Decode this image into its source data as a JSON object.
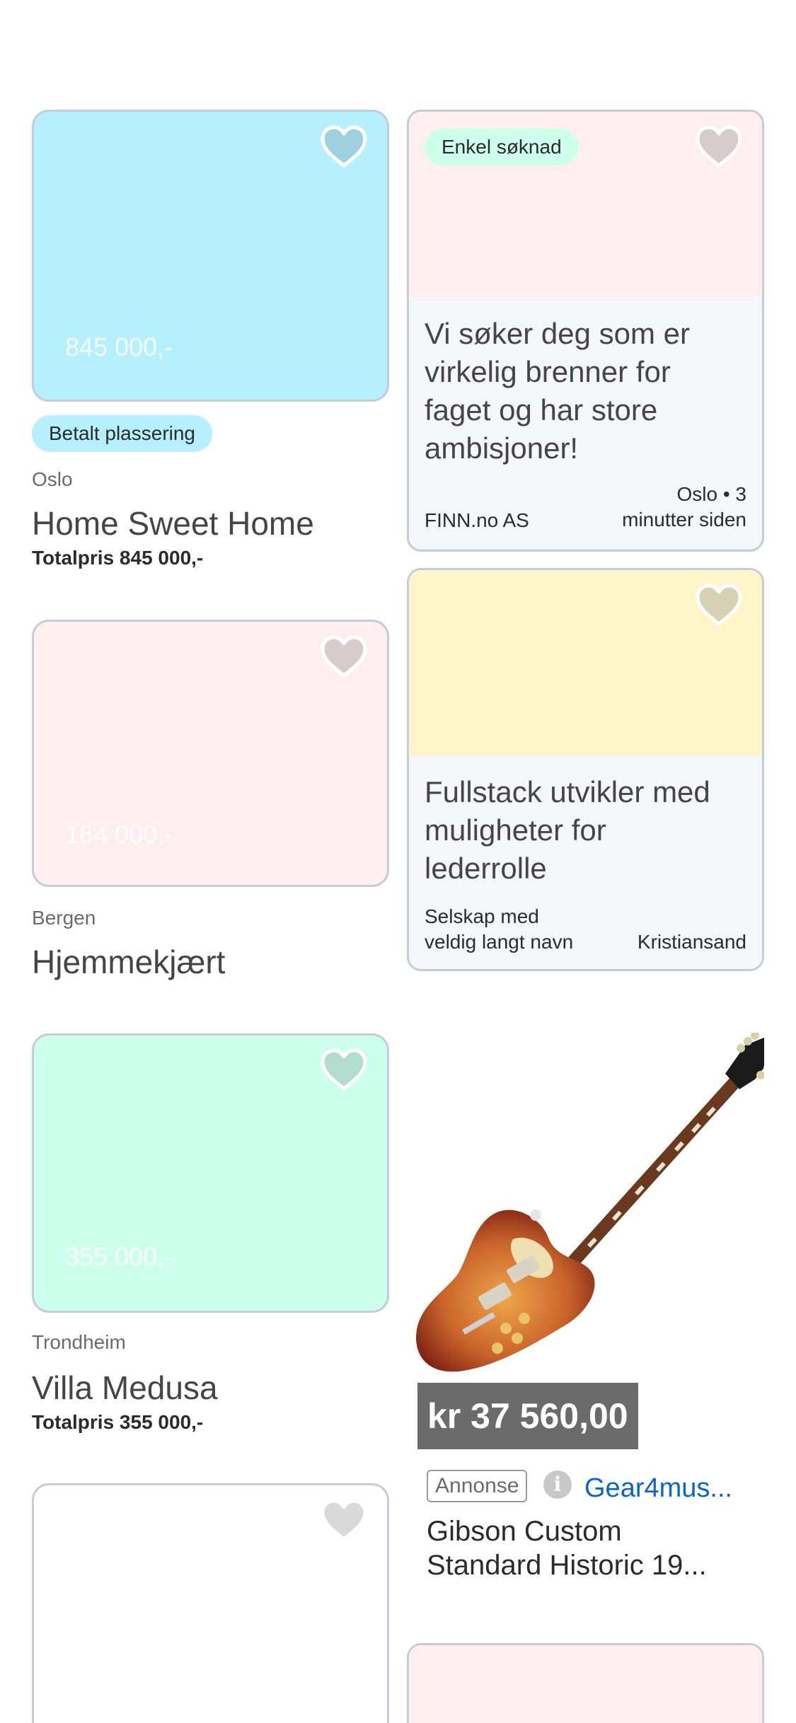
{
  "colors": {
    "accent_blue": "#b6f0ff",
    "accent_pink": "#ffeef0",
    "accent_yellow": "#fff5c8",
    "accent_green": "#ccffec",
    "job_badge_green": "#ccffec",
    "link_blue": "#0b63ce"
  },
  "listings": [
    {
      "price_overlay": "845 000,-",
      "badge": "Betalt plassering",
      "location": "Oslo",
      "title": "Home Sweet Home",
      "total": "Totalpris 845 000,-",
      "favorite_icon": "heart-icon"
    },
    {
      "price_overlay": "164 000,-",
      "location": "Bergen",
      "title": "Hjemmekjært",
      "favorite_icon": "heart-icon"
    },
    {
      "price_overlay": "355 000,-",
      "location": "Trondheim",
      "title": "Villa Medusa",
      "total": "Totalpris 355 000,-",
      "favorite_icon": "heart-icon"
    }
  ],
  "jobs": [
    {
      "badge": "Enkel søknad",
      "title_lines": [
        "Vi søker deg som er",
        "virkelig brenner for",
        "faget og har store",
        "ambisjoner!"
      ],
      "company": "FINN.no AS",
      "meta_right_lines": [
        "Oslo • 3",
        "minutter siden"
      ],
      "favorite_icon": "heart-icon"
    },
    {
      "title_lines": [
        "Fullstack utvikler med",
        "muligheter for",
        "lederrolle"
      ],
      "company_lines": [
        "Selskap med",
        "veldig langt navn"
      ],
      "meta_right_lines": [
        "Kristiansand"
      ],
      "favorite_icon": "heart-icon"
    }
  ],
  "ad": {
    "price": "kr 37 560,00",
    "label": "Annonse",
    "info_icon": "info-icon",
    "advertiser": "Gear4mus...",
    "title_lines": [
      "Gibson Custom",
      "Standard Historic 19..."
    ],
    "image": "electric-guitar-image"
  }
}
